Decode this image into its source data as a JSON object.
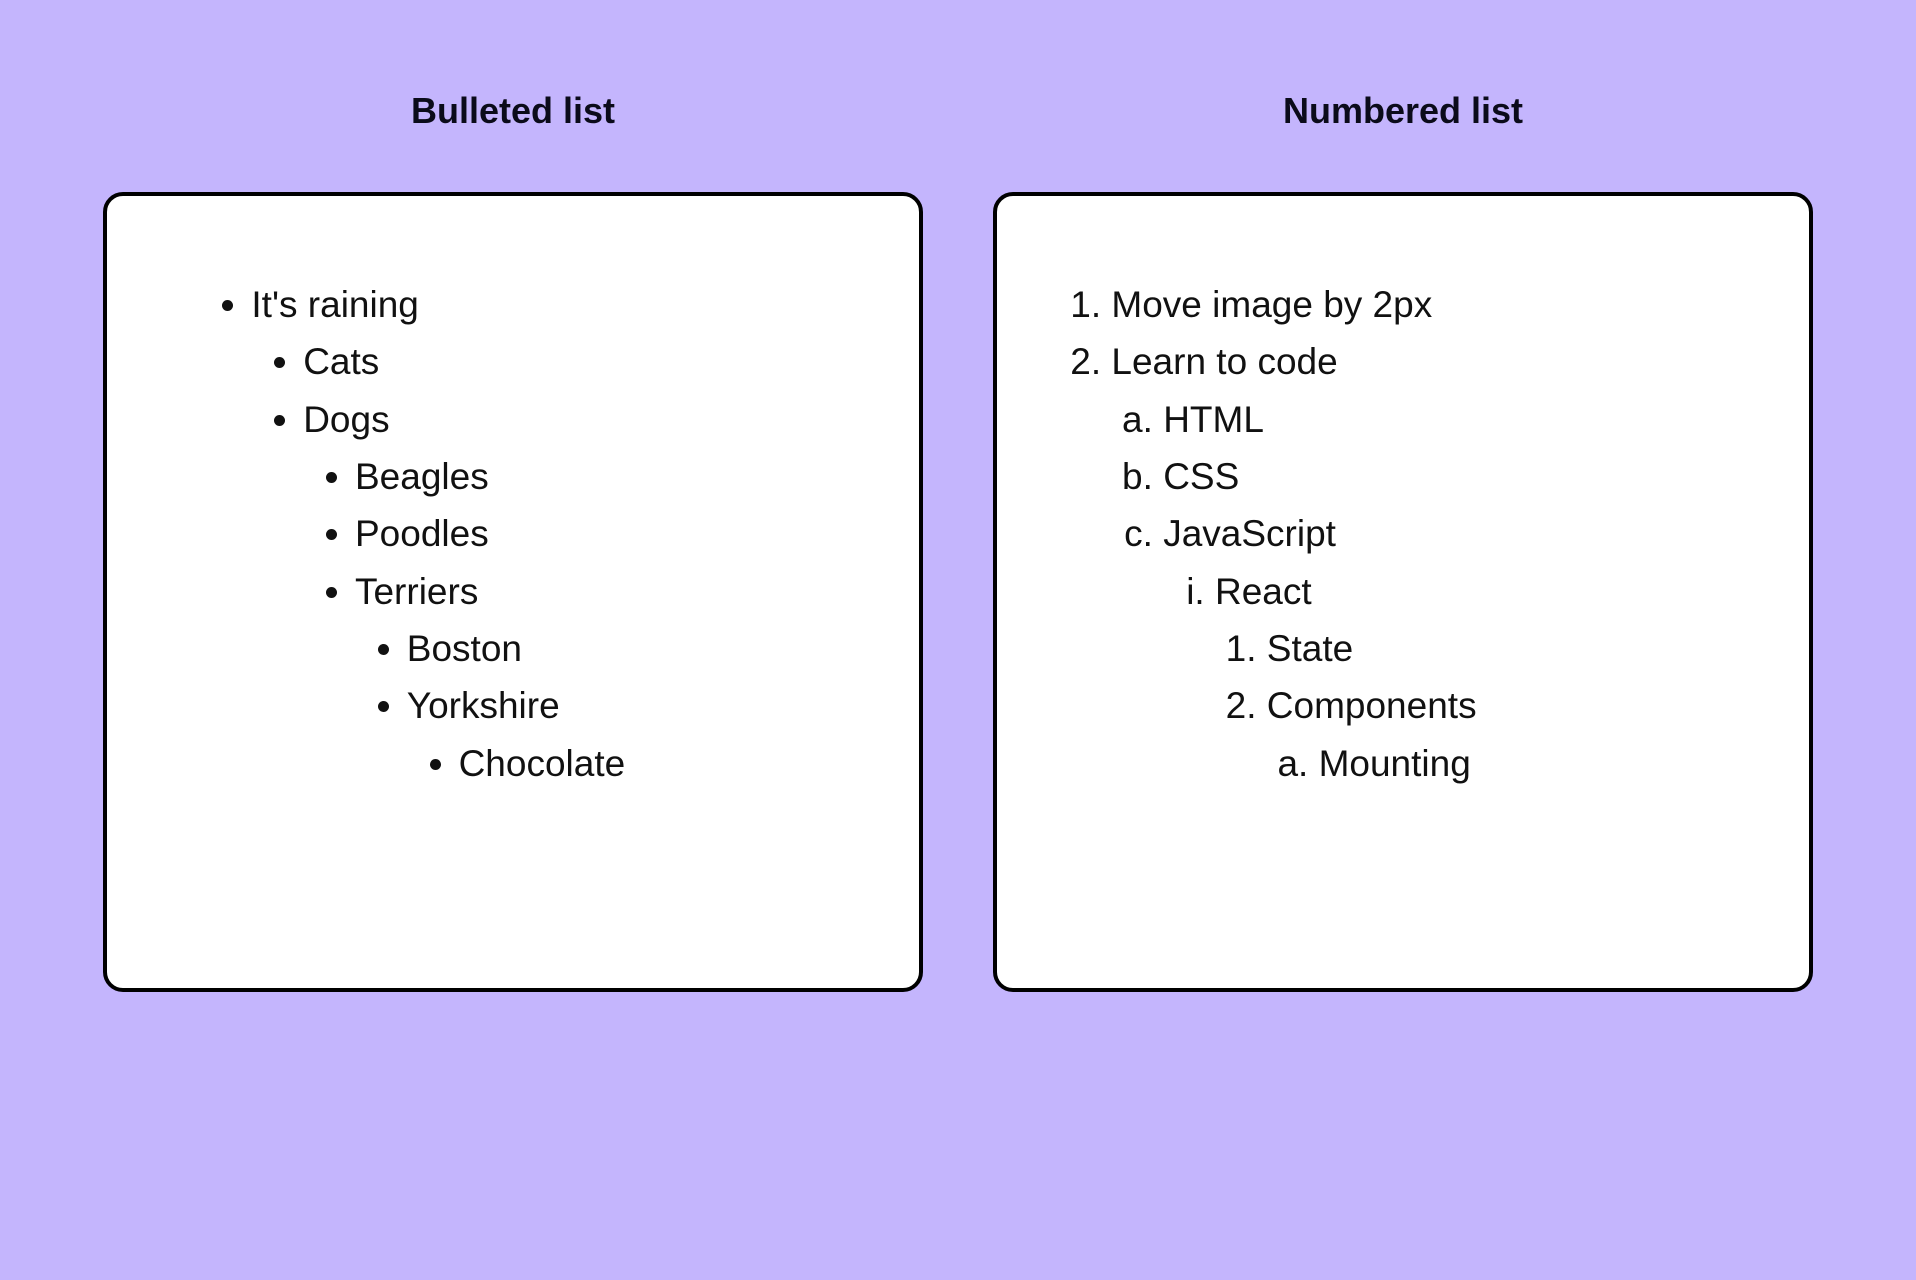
{
  "left": {
    "title": "Bulleted list",
    "items": [
      {
        "text": "It's raining",
        "children": [
          {
            "text": "Cats"
          },
          {
            "text": "Dogs",
            "children": [
              {
                "text": "Beagles"
              },
              {
                "text": "Poodles"
              },
              {
                "text": "Terriers",
                "children": [
                  {
                    "text": "Boston"
                  },
                  {
                    "text": "Yorkshire",
                    "children": [
                      {
                        "text": "Chocolate"
                      }
                    ]
                  }
                ]
              }
            ]
          }
        ]
      }
    ]
  },
  "right": {
    "title": "Numbered list",
    "items": [
      {
        "text": "Move image by 2px"
      },
      {
        "text": "Learn to code",
        "children": [
          {
            "text": "HTML"
          },
          {
            "text": "CSS"
          },
          {
            "text": "JavaScript",
            "children": [
              {
                "text": "React",
                "children": [
                  {
                    "text": "State"
                  },
                  {
                    "text": "Components",
                    "children": [
                      {
                        "text": "Mounting"
                      }
                    ]
                  }
                ]
              }
            ]
          }
        ]
      }
    ]
  }
}
